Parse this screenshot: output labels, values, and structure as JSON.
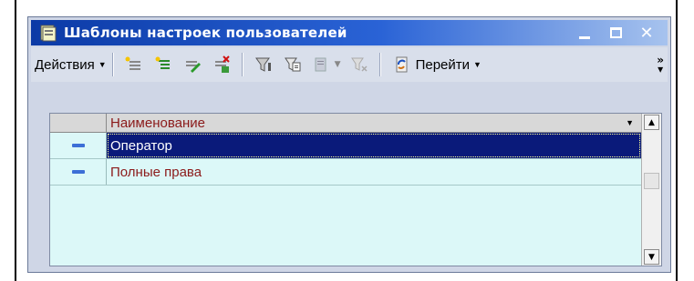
{
  "window": {
    "title": "Шаблоны настроек пользователей",
    "close_glyph": "✕"
  },
  "toolbar": {
    "actions_label": "Действия",
    "goto_label": "Перейти",
    "icons": [
      "add-icon",
      "add-group-icon",
      "edit-icon",
      "delete-mark-icon",
      "filter-icon",
      "filter-settings-icon",
      "filter-list-icon",
      "clear-filter-icon",
      "refresh-icon"
    ]
  },
  "table": {
    "column_header": "Наименование",
    "rows": [
      {
        "name": "Оператор",
        "selected": true
      },
      {
        "name": "Полные права",
        "selected": false
      }
    ]
  },
  "colors": {
    "title_start": "#0b3aa6",
    "grid_bg": "#dcf8f8",
    "selected_bg": "#0a1a7a",
    "text_red": "#8b1a1a"
  }
}
